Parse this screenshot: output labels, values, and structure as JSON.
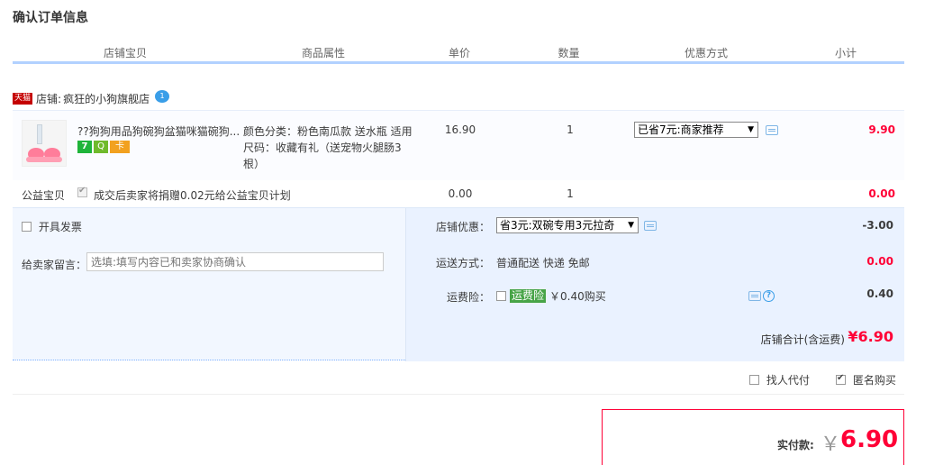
{
  "page": {
    "title": "确认订单信息"
  },
  "table_header": {
    "columns": [
      "店铺宝贝",
      "商品属性",
      "单价",
      "数量",
      "优惠方式",
      "小计"
    ]
  },
  "shop": {
    "badge": "天猫",
    "label": "店铺:",
    "name": "疯狂的小狗旗舰店",
    "chat_badge": "1"
  },
  "item": {
    "title": "??狗狗用品狗碗狗盆猫咪猫碗狗...",
    "badges": [
      "7",
      "Q",
      "卡"
    ],
    "props": "颜色分类：粉色南瓜款 送水瓶 适用尺码：收藏有礼（送宠物火腿肠3根）",
    "price": "16.90",
    "qty": "1",
    "promo": "已省7元:商家推荐",
    "subtotal": "9.90"
  },
  "charity": {
    "label": "公益宝贝",
    "desc": "成交后卖家将捐赠0.02元给公益宝贝计划",
    "price": "0.00",
    "qty": "1",
    "subtotal": "0.00"
  },
  "options": {
    "invoice": "开具发票",
    "memo_label": "给卖家留言：",
    "memo_placeholder": "选填:填写内容已和卖家协商确认",
    "store_discount_label": "店铺优惠：",
    "store_discount_value": "省3元:双碗专用3元拉奇",
    "store_discount_amount": "-3.00",
    "shipping_label": "运送方式：",
    "shipping_value": "普通配送 快递 免邮",
    "shipping_amount": "0.00",
    "insurance_label": "运费险：",
    "insurance_tag": "运费险",
    "insurance_price": "￥0.40购买",
    "insurance_amount": "0.40",
    "total_label": "店铺合计(含运费)",
    "total_amount": "¥6.90"
  },
  "bottom": {
    "proxy_pay": "找人代付",
    "anonymous": "匿名购买"
  },
  "payment": {
    "label": "实付款:",
    "currency": "￥",
    "amount": "6.90"
  },
  "colors": {
    "accent_red": "#ff0036",
    "header_line": "#b2d1ff",
    "panel_bg": "#f2f7ff",
    "tmall_red": "#c40000"
  }
}
